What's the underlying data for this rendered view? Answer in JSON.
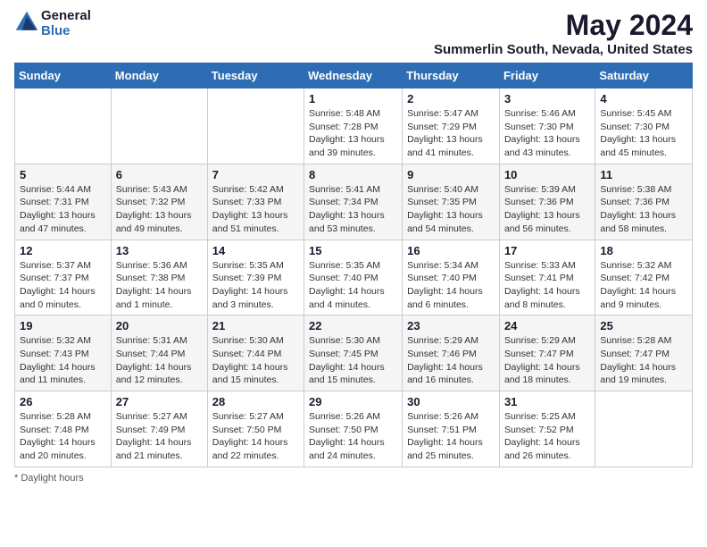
{
  "logo": {
    "general": "General",
    "blue": "Blue"
  },
  "title": "May 2024",
  "subtitle": "Summerlin South, Nevada, United States",
  "weekdays": [
    "Sunday",
    "Monday",
    "Tuesday",
    "Wednesday",
    "Thursday",
    "Friday",
    "Saturday"
  ],
  "footer": {
    "daylight_label": "Daylight hours"
  },
  "weeks": [
    [
      {
        "day": "",
        "sunrise": "",
        "sunset": "",
        "daylight": ""
      },
      {
        "day": "",
        "sunrise": "",
        "sunset": "",
        "daylight": ""
      },
      {
        "day": "",
        "sunrise": "",
        "sunset": "",
        "daylight": ""
      },
      {
        "day": "1",
        "sunrise": "Sunrise: 5:48 AM",
        "sunset": "Sunset: 7:28 PM",
        "daylight": "Daylight: 13 hours and 39 minutes."
      },
      {
        "day": "2",
        "sunrise": "Sunrise: 5:47 AM",
        "sunset": "Sunset: 7:29 PM",
        "daylight": "Daylight: 13 hours and 41 minutes."
      },
      {
        "day": "3",
        "sunrise": "Sunrise: 5:46 AM",
        "sunset": "Sunset: 7:30 PM",
        "daylight": "Daylight: 13 hours and 43 minutes."
      },
      {
        "day": "4",
        "sunrise": "Sunrise: 5:45 AM",
        "sunset": "Sunset: 7:30 PM",
        "daylight": "Daylight: 13 hours and 45 minutes."
      }
    ],
    [
      {
        "day": "5",
        "sunrise": "Sunrise: 5:44 AM",
        "sunset": "Sunset: 7:31 PM",
        "daylight": "Daylight: 13 hours and 47 minutes."
      },
      {
        "day": "6",
        "sunrise": "Sunrise: 5:43 AM",
        "sunset": "Sunset: 7:32 PM",
        "daylight": "Daylight: 13 hours and 49 minutes."
      },
      {
        "day": "7",
        "sunrise": "Sunrise: 5:42 AM",
        "sunset": "Sunset: 7:33 PM",
        "daylight": "Daylight: 13 hours and 51 minutes."
      },
      {
        "day": "8",
        "sunrise": "Sunrise: 5:41 AM",
        "sunset": "Sunset: 7:34 PM",
        "daylight": "Daylight: 13 hours and 53 minutes."
      },
      {
        "day": "9",
        "sunrise": "Sunrise: 5:40 AM",
        "sunset": "Sunset: 7:35 PM",
        "daylight": "Daylight: 13 hours and 54 minutes."
      },
      {
        "day": "10",
        "sunrise": "Sunrise: 5:39 AM",
        "sunset": "Sunset: 7:36 PM",
        "daylight": "Daylight: 13 hours and 56 minutes."
      },
      {
        "day": "11",
        "sunrise": "Sunrise: 5:38 AM",
        "sunset": "Sunset: 7:36 PM",
        "daylight": "Daylight: 13 hours and 58 minutes."
      }
    ],
    [
      {
        "day": "12",
        "sunrise": "Sunrise: 5:37 AM",
        "sunset": "Sunset: 7:37 PM",
        "daylight": "Daylight: 14 hours and 0 minutes."
      },
      {
        "day": "13",
        "sunrise": "Sunrise: 5:36 AM",
        "sunset": "Sunset: 7:38 PM",
        "daylight": "Daylight: 14 hours and 1 minute."
      },
      {
        "day": "14",
        "sunrise": "Sunrise: 5:35 AM",
        "sunset": "Sunset: 7:39 PM",
        "daylight": "Daylight: 14 hours and 3 minutes."
      },
      {
        "day": "15",
        "sunrise": "Sunrise: 5:35 AM",
        "sunset": "Sunset: 7:40 PM",
        "daylight": "Daylight: 14 hours and 4 minutes."
      },
      {
        "day": "16",
        "sunrise": "Sunrise: 5:34 AM",
        "sunset": "Sunset: 7:40 PM",
        "daylight": "Daylight: 14 hours and 6 minutes."
      },
      {
        "day": "17",
        "sunrise": "Sunrise: 5:33 AM",
        "sunset": "Sunset: 7:41 PM",
        "daylight": "Daylight: 14 hours and 8 minutes."
      },
      {
        "day": "18",
        "sunrise": "Sunrise: 5:32 AM",
        "sunset": "Sunset: 7:42 PM",
        "daylight": "Daylight: 14 hours and 9 minutes."
      }
    ],
    [
      {
        "day": "19",
        "sunrise": "Sunrise: 5:32 AM",
        "sunset": "Sunset: 7:43 PM",
        "daylight": "Daylight: 14 hours and 11 minutes."
      },
      {
        "day": "20",
        "sunrise": "Sunrise: 5:31 AM",
        "sunset": "Sunset: 7:44 PM",
        "daylight": "Daylight: 14 hours and 12 minutes."
      },
      {
        "day": "21",
        "sunrise": "Sunrise: 5:30 AM",
        "sunset": "Sunset: 7:44 PM",
        "daylight": "Daylight: 14 hours and 15 minutes."
      },
      {
        "day": "22",
        "sunrise": "Sunrise: 5:30 AM",
        "sunset": "Sunset: 7:45 PM",
        "daylight": "Daylight: 14 hours and 15 minutes."
      },
      {
        "day": "23",
        "sunrise": "Sunrise: 5:29 AM",
        "sunset": "Sunset: 7:46 PM",
        "daylight": "Daylight: 14 hours and 16 minutes."
      },
      {
        "day": "24",
        "sunrise": "Sunrise: 5:29 AM",
        "sunset": "Sunset: 7:47 PM",
        "daylight": "Daylight: 14 hours and 18 minutes."
      },
      {
        "day": "25",
        "sunrise": "Sunrise: 5:28 AM",
        "sunset": "Sunset: 7:47 PM",
        "daylight": "Daylight: 14 hours and 19 minutes."
      }
    ],
    [
      {
        "day": "26",
        "sunrise": "Sunrise: 5:28 AM",
        "sunset": "Sunset: 7:48 PM",
        "daylight": "Daylight: 14 hours and 20 minutes."
      },
      {
        "day": "27",
        "sunrise": "Sunrise: 5:27 AM",
        "sunset": "Sunset: 7:49 PM",
        "daylight": "Daylight: 14 hours and 21 minutes."
      },
      {
        "day": "28",
        "sunrise": "Sunrise: 5:27 AM",
        "sunset": "Sunset: 7:50 PM",
        "daylight": "Daylight: 14 hours and 22 minutes."
      },
      {
        "day": "29",
        "sunrise": "Sunrise: 5:26 AM",
        "sunset": "Sunset: 7:50 PM",
        "daylight": "Daylight: 14 hours and 24 minutes."
      },
      {
        "day": "30",
        "sunrise": "Sunrise: 5:26 AM",
        "sunset": "Sunset: 7:51 PM",
        "daylight": "Daylight: 14 hours and 25 minutes."
      },
      {
        "day": "31",
        "sunrise": "Sunrise: 5:25 AM",
        "sunset": "Sunset: 7:52 PM",
        "daylight": "Daylight: 14 hours and 26 minutes."
      },
      {
        "day": "",
        "sunrise": "",
        "sunset": "",
        "daylight": ""
      }
    ]
  ]
}
